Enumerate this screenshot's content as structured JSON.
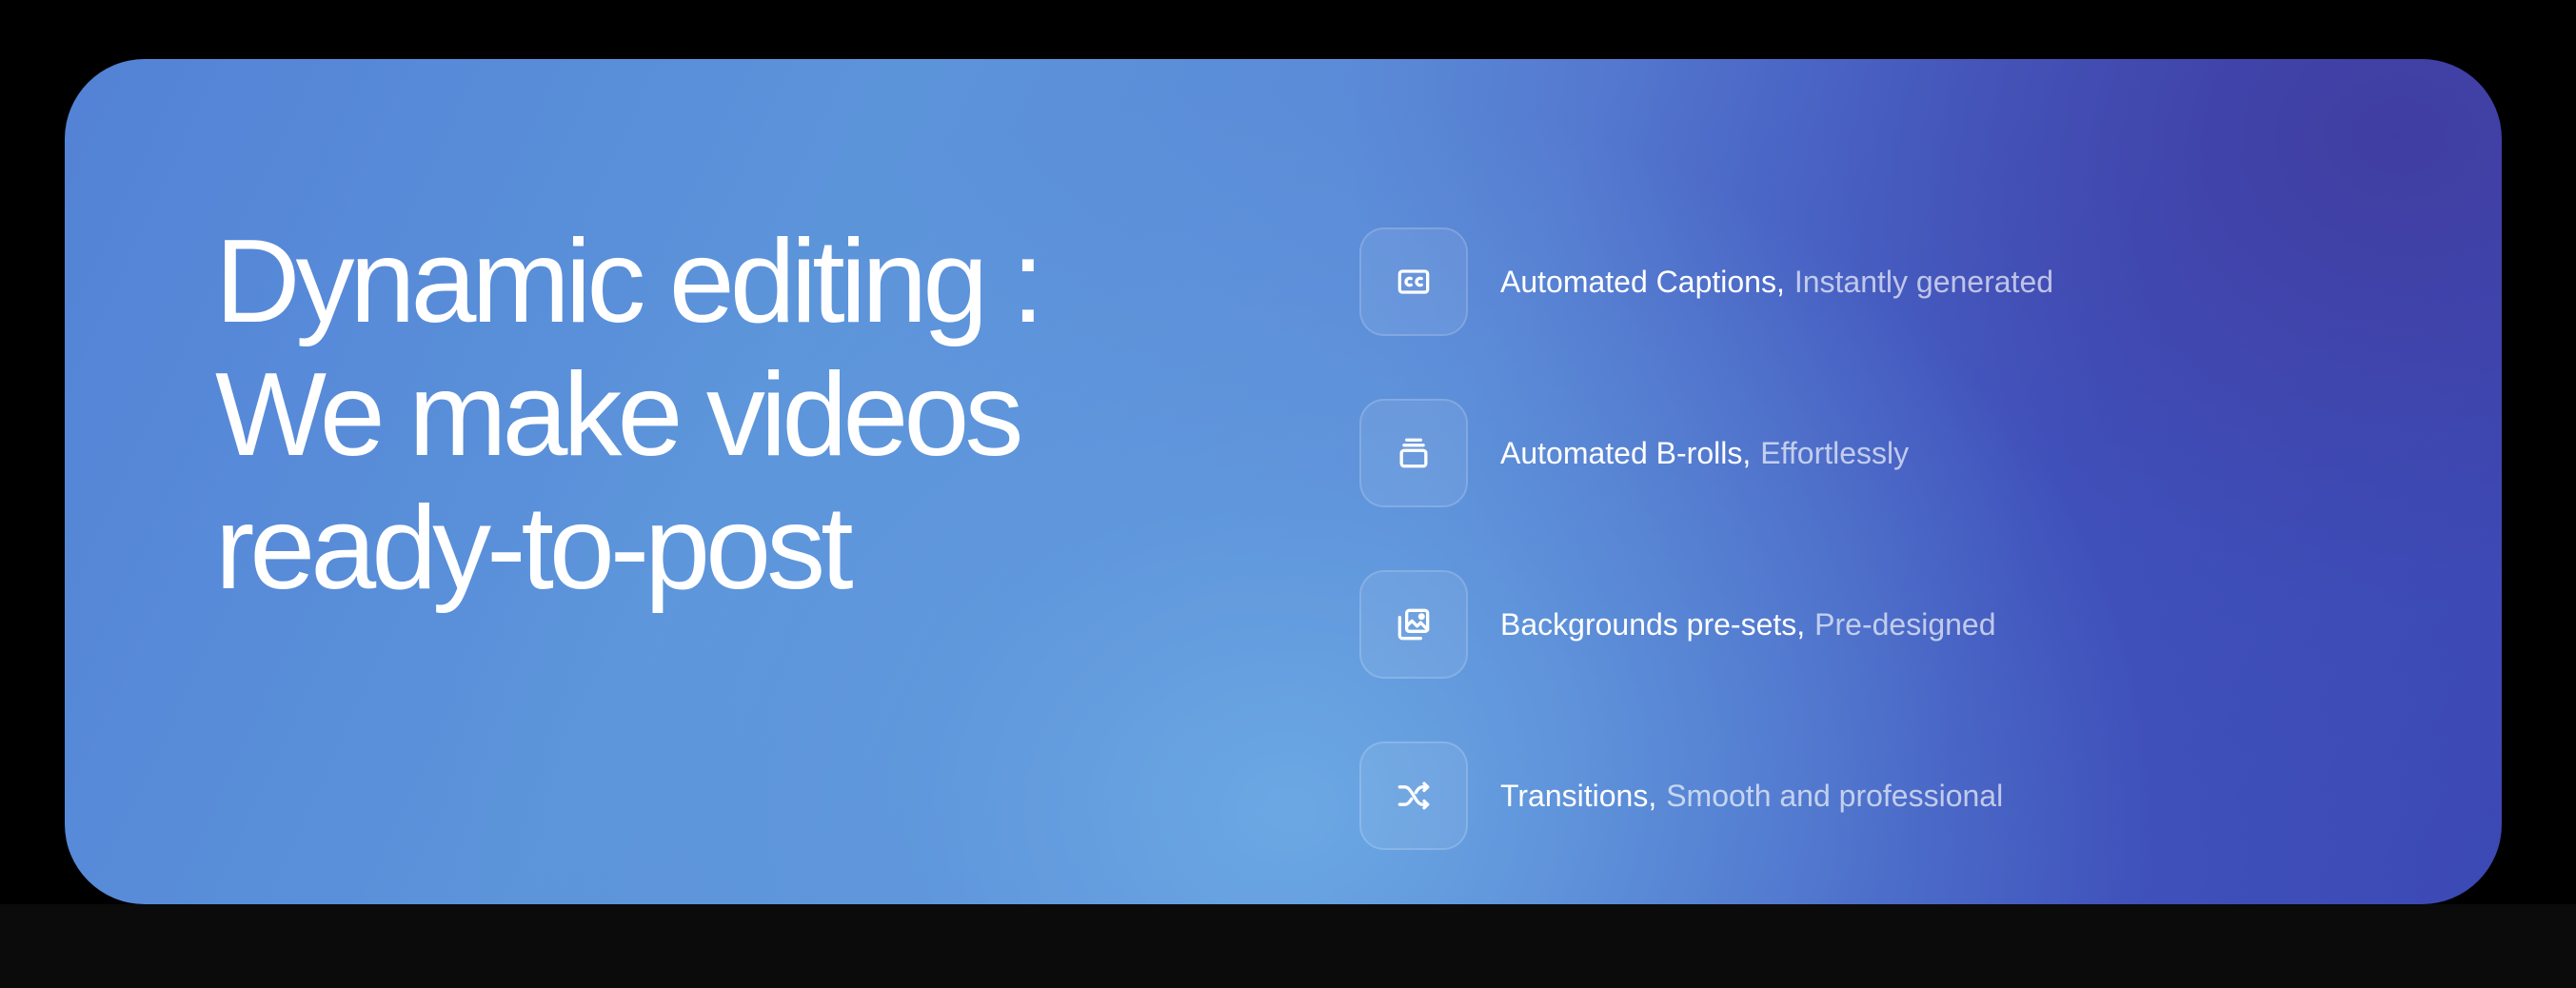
{
  "headline": {
    "lines": [
      "Dynamic editing :",
      "We make videos",
      "ready-to-post"
    ]
  },
  "features": [
    {
      "icon": "captions-icon",
      "title": "Automated Captions,",
      "description": "Instantly generated"
    },
    {
      "icon": "stack-icon",
      "title": "Automated B-rolls,",
      "description": "Effortlessly"
    },
    {
      "icon": "image-layers-icon",
      "title": "Backgrounds pre-sets,",
      "description": "Pre-designed"
    },
    {
      "icon": "shuffle-icon",
      "title": "Transitions,",
      "description": "Smooth and professional"
    }
  ],
  "colors": {
    "page_background": "#000000",
    "gradient_light": "#6caae4",
    "gradient_dark": "#3c49b4",
    "text_primary": "#ffffff"
  }
}
